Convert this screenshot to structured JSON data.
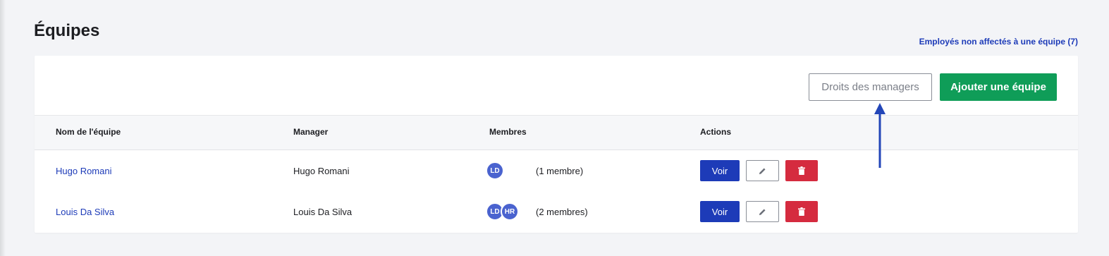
{
  "page": {
    "title": "Équipes",
    "unassigned_link": "Employés non affectés à une équipe (7)"
  },
  "toolbar": {
    "manager_rights_label": "Droits des managers",
    "add_team_label": "Ajouter une équipe"
  },
  "table": {
    "columns": [
      "Nom de l'équipe",
      "Manager",
      "Membres",
      "Actions"
    ],
    "rows": [
      {
        "team": "Hugo Romani",
        "manager": "Hugo Romani",
        "avatars": [
          "LD"
        ],
        "member_count": "(1 membre)",
        "view_label": "Voir"
      },
      {
        "team": "Louis Da Silva",
        "manager": "Louis Da Silva",
        "avatars": [
          "LD",
          "HR"
        ],
        "member_count": "(2 membres)",
        "view_label": "Voir"
      }
    ]
  },
  "icons": {
    "edit": "pencil-icon",
    "delete": "trash-icon",
    "annotation": "arrow-up-icon"
  },
  "colors": {
    "primary_green": "#0f9d58",
    "link_blue": "#1d3bb8",
    "danger_red": "#d52b3f",
    "avatar_blue": "#4a63cf",
    "annotation_arrow": "#2346b8"
  }
}
